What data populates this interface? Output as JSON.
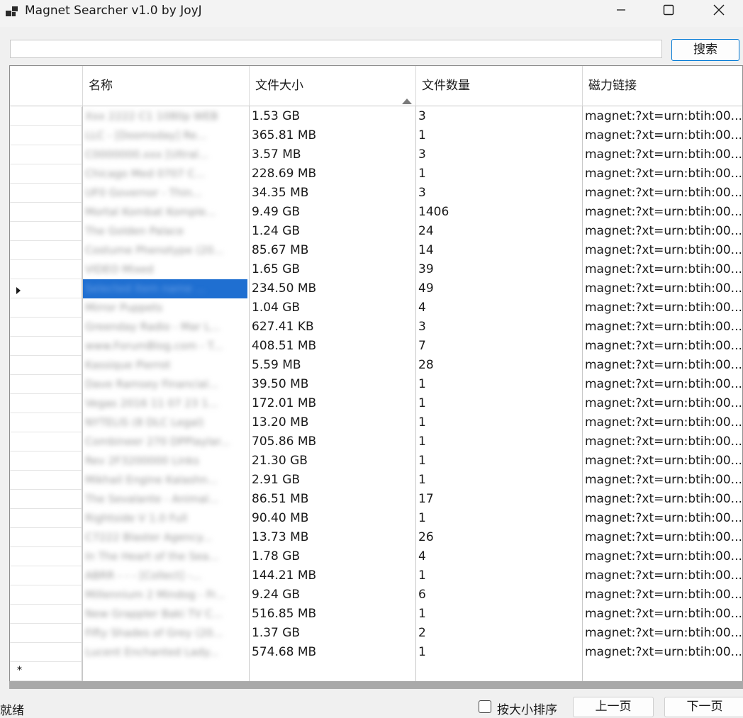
{
  "window": {
    "title": "Magnet Searcher v1.0 by JoyJ"
  },
  "search": {
    "value": "",
    "button_label": "搜索"
  },
  "grid": {
    "columns": [
      "名称",
      "文件大小",
      "文件数量",
      "磁力链接"
    ],
    "sorted_column": "文件大小",
    "sort_direction": "ascending",
    "selected_row": 9,
    "new_row_marker": "*",
    "rows": [
      {
        "name": "Xxx 2222 C1 1080p WEB",
        "size": "1.53 GB",
        "count": "3",
        "magnet": "magnet:?xt=urn:btih:00..."
      },
      {
        "name": "LLC - [Doomsday] Re...",
        "size": "365.81 MB",
        "count": "1",
        "magnet": "magnet:?xt=urn:btih:00..."
      },
      {
        "name": "C0000000.xxx [Ultral...",
        "size": "3.57 MB",
        "count": "3",
        "magnet": "magnet:?xt=urn:btih:00..."
      },
      {
        "name": "Chicago Med 0707 C...",
        "size": "228.69 MB",
        "count": "1",
        "magnet": "magnet:?xt=urn:btih:00..."
      },
      {
        "name": "UF0 Governor - Thin...",
        "size": "34.35 MB",
        "count": "3",
        "magnet": "magnet:?xt=urn:btih:00..."
      },
      {
        "name": "Mortal Kombat Komple...",
        "size": "9.49 GB",
        "count": "1406",
        "magnet": "magnet:?xt=urn:btih:00..."
      },
      {
        "name": "The Golden Palace",
        "size": "1.24 GB",
        "count": "24",
        "magnet": "magnet:?xt=urn:btih:00..."
      },
      {
        "name": "Costume Phenotype (20...",
        "size": "85.67 MB",
        "count": "14",
        "magnet": "magnet:?xt=urn:btih:00..."
      },
      {
        "name": "VIDEO Mixed",
        "size": "1.65 GB",
        "count": "39",
        "magnet": "magnet:?xt=urn:btih:00..."
      },
      {
        "name": "Selected item name ...",
        "size": "234.50 MB",
        "count": "49",
        "magnet": "magnet:?xt=urn:btih:00..."
      },
      {
        "name": "Mirror Puppets",
        "size": "1.04 GB",
        "count": "4",
        "magnet": "magnet:?xt=urn:btih:00..."
      },
      {
        "name": "Greenday Radio - Mar L...",
        "size": "627.41 KB",
        "count": "3",
        "magnet": "magnet:?xt=urn:btih:00..."
      },
      {
        "name": "www.ForumBlog.com - T...",
        "size": "408.51 MB",
        "count": "7",
        "magnet": "magnet:?xt=urn:btih:00..."
      },
      {
        "name": "Kassique Pierrot",
        "size": "5.59 MB",
        "count": "28",
        "magnet": "magnet:?xt=urn:btih:00..."
      },
      {
        "name": "Dave Ramsey Financial...",
        "size": "39.50 MB",
        "count": "1",
        "magnet": "magnet:?xt=urn:btih:00..."
      },
      {
        "name": "Vegas 2016 11 07 23 1...",
        "size": "172.01 MB",
        "count": "1",
        "magnet": "magnet:?xt=urn:btih:00..."
      },
      {
        "name": "NYTELIS (8 DLC Legal)",
        "size": "13.20 MB",
        "count": "1",
        "magnet": "magnet:?xt=urn:btih:00..."
      },
      {
        "name": "Combineer 270 DPPlaylar...",
        "size": "705.86 MB",
        "count": "1",
        "magnet": "magnet:?xt=urn:btih:00..."
      },
      {
        "name": "Rev 2F3200000 Links",
        "size": "21.30 GB",
        "count": "1",
        "magnet": "magnet:?xt=urn:btih:00..."
      },
      {
        "name": "Mikhail Engine Kalashn...",
        "size": "2.91 GB",
        "count": "1",
        "magnet": "magnet:?xt=urn:btih:00..."
      },
      {
        "name": "The Sevalante - Animal...",
        "size": "86.51 MB",
        "count": "17",
        "magnet": "magnet:?xt=urn:btih:00..."
      },
      {
        "name": "Rightside V 1.0 Full",
        "size": "90.40 MB",
        "count": "1",
        "magnet": "magnet:?xt=urn:btih:00..."
      },
      {
        "name": "C7222 Blaster Agency...",
        "size": "13.73 MB",
        "count": "26",
        "magnet": "magnet:?xt=urn:btih:00..."
      },
      {
        "name": "In The Heart of the Sea...",
        "size": "1.78 GB",
        "count": "4",
        "magnet": "magnet:?xt=urn:btih:00..."
      },
      {
        "name": "ABRR - - - [Collect] -...",
        "size": "144.21 MB",
        "count": "1",
        "magnet": "magnet:?xt=urn:btih:00..."
      },
      {
        "name": "Millennium 2 Mindog - Fr...",
        "size": "9.24 GB",
        "count": "6",
        "magnet": "magnet:?xt=urn:btih:00..."
      },
      {
        "name": "New Grappler Baki TV C...",
        "size": "516.85 MB",
        "count": "1",
        "magnet": "magnet:?xt=urn:btih:00..."
      },
      {
        "name": "Fifty Shades of Grey (20...",
        "size": "1.37 GB",
        "count": "2",
        "magnet": "magnet:?xt=urn:btih:00..."
      },
      {
        "name": "Lucent Enchanted Lady...",
        "size": "574.68 MB",
        "count": "1",
        "magnet": "magnet:?xt=urn:btih:00..."
      }
    ]
  },
  "status": {
    "text": "就绪",
    "sort_checkbox_label": "按大小排序",
    "sort_checked": false,
    "prev_label": "上一页",
    "next_label": "下一页"
  },
  "colors": {
    "selection": "#1f6fd1",
    "accent_border": "#0078d4"
  },
  "icons": [
    "app-icon",
    "minimize-icon",
    "maximize-icon",
    "close-icon",
    "sort-ascending-icon",
    "current-row-arrow-icon"
  ]
}
